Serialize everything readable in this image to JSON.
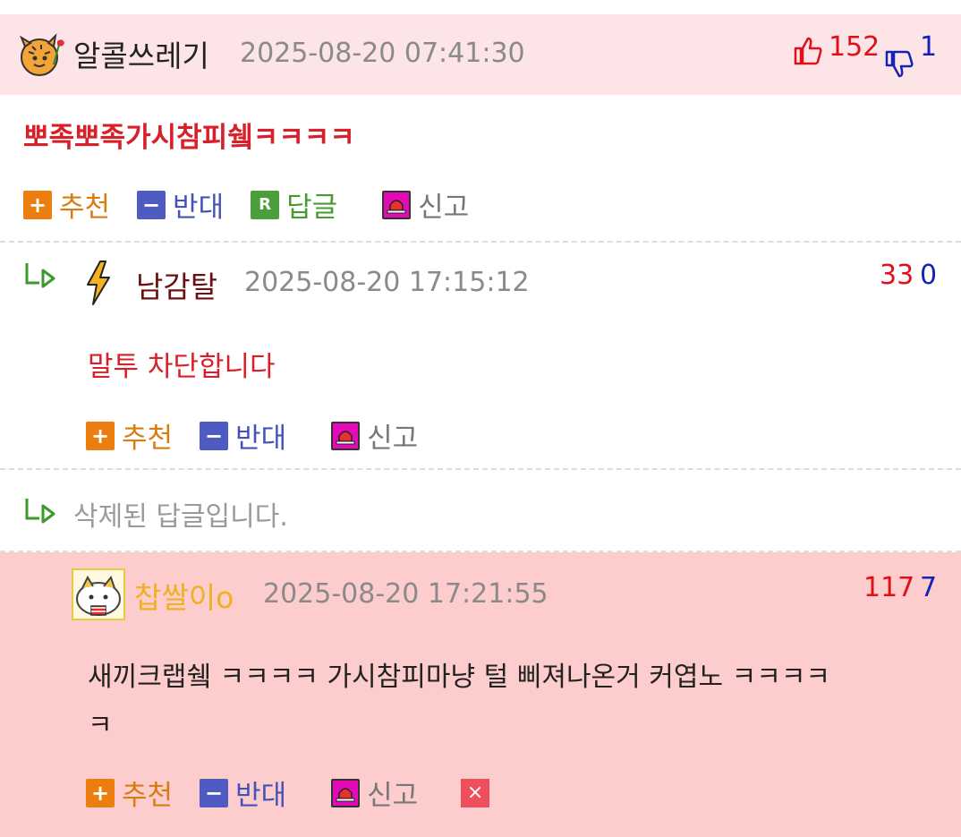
{
  "comments": [
    {
      "nick": "알콜쓰레기",
      "date": "2025-08-20 07:41:30",
      "up": "152",
      "down": "1",
      "text": "뽀족뽀족가시참피쉨ㅋㅋㅋㅋ",
      "actions": {
        "recommend": "추천",
        "oppose": "반대",
        "reply": "답글",
        "report": "신고"
      }
    },
    {
      "nick": "남감탈",
      "date": "2025-08-20 17:15:12",
      "up": "33",
      "down": "0",
      "text": "말투 차단합니다",
      "actions": {
        "recommend": "추천",
        "oppose": "반대",
        "report": "신고"
      }
    },
    {
      "deleted_text": "삭제된 답글입니다."
    },
    {
      "nick": "찹쌀이o",
      "date": "2025-08-20 17:21:55",
      "up": "117",
      "down": "7",
      "text_line1": "새끼크랩쉨 ㅋㅋㅋㅋ 가시참피마냥 털 삐져나온거 커엽노 ㅋㅋㅋㅋ",
      "text_line2": "ㅋ",
      "actions": {
        "recommend": "추천",
        "oppose": "반대",
        "report": "신고",
        "delete": "×"
      }
    }
  ],
  "colors": {
    "header_pink": "#fde4e6",
    "highlight_pink": "#fdcccc",
    "up": "#e0101a",
    "down": "#1522b8"
  },
  "icons": [
    "tiger-avatar",
    "thumbs-up-icon",
    "thumbs-down-icon",
    "reply-arrow-icon",
    "lightning-icon",
    "cat-avatar",
    "plus-icon",
    "minus-icon",
    "reply-icon",
    "siren-icon",
    "close-icon"
  ]
}
